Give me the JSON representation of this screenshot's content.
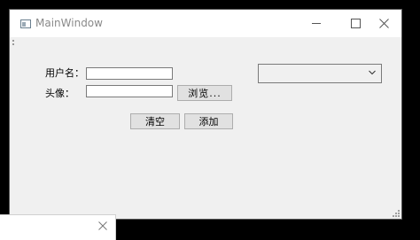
{
  "window": {
    "title": "MainWindow"
  },
  "form": {
    "username_label": "用户名：",
    "avatar_label": "头像：",
    "username_value": "",
    "avatar_value": "",
    "browse_label": "浏览...",
    "clear_label": "清空",
    "add_label": "添加",
    "combo_selected": ""
  },
  "icons": {
    "app": "app-window-icon",
    "minimize": "minimize-icon",
    "maximize": "maximize-icon",
    "close": "close-icon",
    "combo_arrow": "chevron-down-icon",
    "popup_close": "close-icon"
  }
}
